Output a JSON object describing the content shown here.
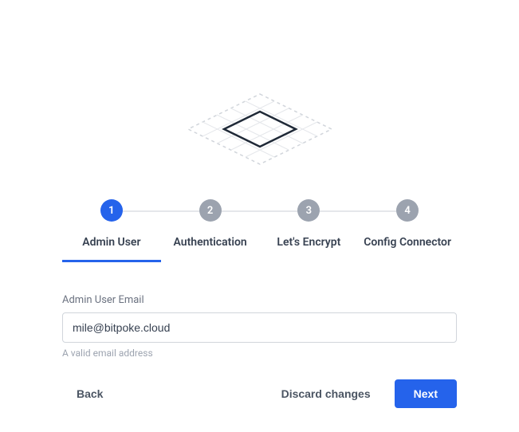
{
  "illustration": {
    "name": "platform-diamond-illustration"
  },
  "stepper": {
    "steps": [
      {
        "num": "1",
        "label": "Admin User",
        "active": true
      },
      {
        "num": "2",
        "label": "Authentication",
        "active": false
      },
      {
        "num": "3",
        "label": "Let's Encrypt",
        "active": false
      },
      {
        "num": "4",
        "label": "Config Connector",
        "active": false
      }
    ]
  },
  "form": {
    "email_label": "Admin User Email",
    "email_value": "mile@bitpoke.cloud",
    "email_help": "A valid email address"
  },
  "buttons": {
    "back": "Back",
    "discard": "Discard changes",
    "next": "Next"
  }
}
